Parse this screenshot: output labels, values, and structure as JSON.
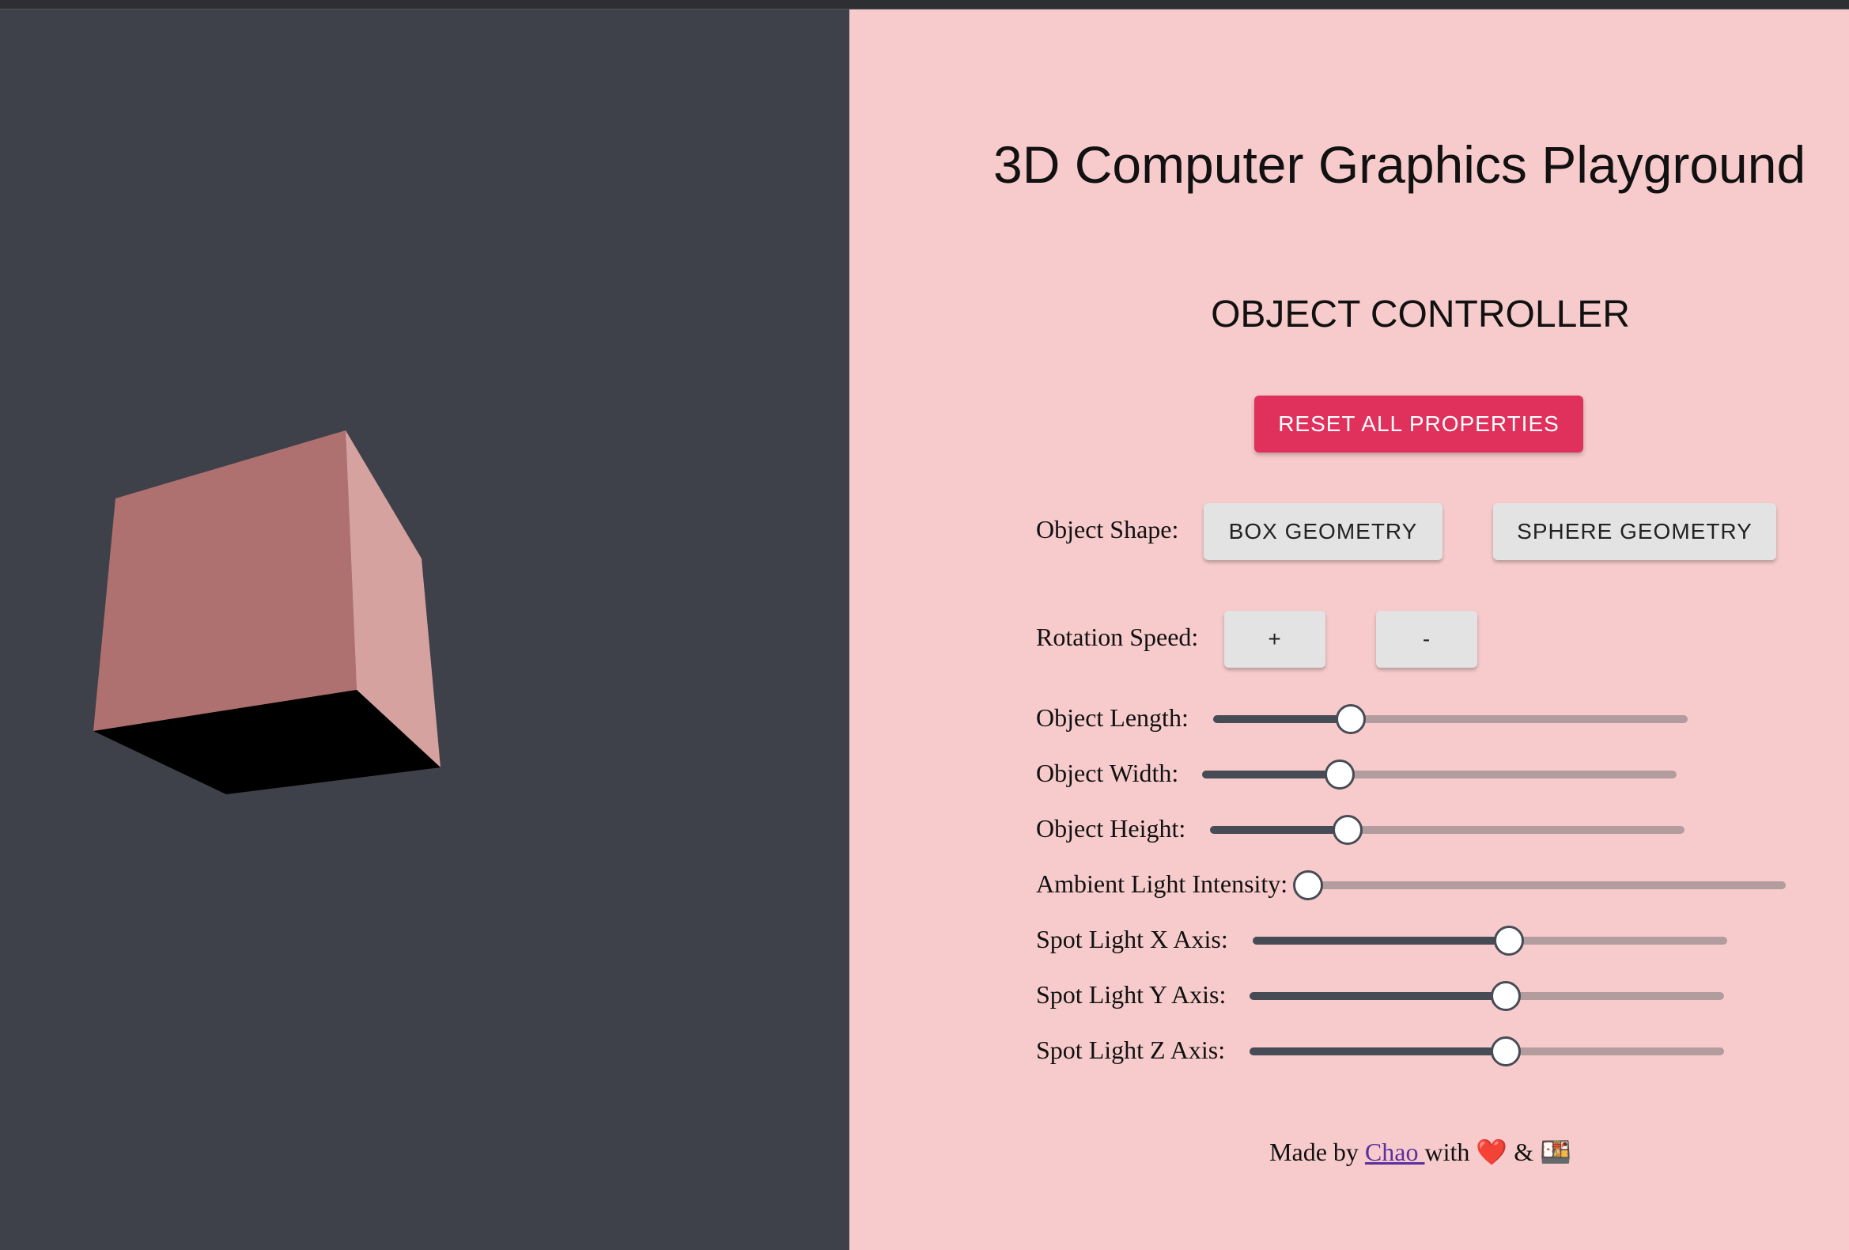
{
  "header": {
    "title": "3D Computer Graphics Playground"
  },
  "controller": {
    "heading": "OBJECT CONTROLLER",
    "reset_label": "RESET ALL PROPERTIES",
    "shape": {
      "label": "Object Shape:",
      "box_label": "BOX GEOMETRY",
      "sphere_label": "SPHERE GEOMETRY"
    },
    "rotation": {
      "label": "Rotation Speed:",
      "increase_label": "+",
      "decrease_label": "-"
    },
    "sliders": [
      {
        "label": "Object Length:",
        "value": 0.29
      },
      {
        "label": "Object Width:",
        "value": 0.29
      },
      {
        "label": "Object Height:",
        "value": 0.29
      },
      {
        "label": "Ambient Light Intensity:",
        "value": 0.0
      },
      {
        "label": "Spot Light X Axis:",
        "value": 0.54
      },
      {
        "label": "Spot Light Y Axis:",
        "value": 0.54
      },
      {
        "label": "Spot Light Z Axis:",
        "value": 0.54
      }
    ]
  },
  "footer": {
    "made_by": "Made by",
    "author_link": "Chao ",
    "with_text": "with",
    "heart_emoji": "❤️",
    "amp": "&",
    "second_emoji": "🍱"
  },
  "colors": {
    "viewport_bg": "#3e4149",
    "panel_bg": "#f7cbcb",
    "accent": "#e0305c",
    "cube": "#c98a8a"
  }
}
